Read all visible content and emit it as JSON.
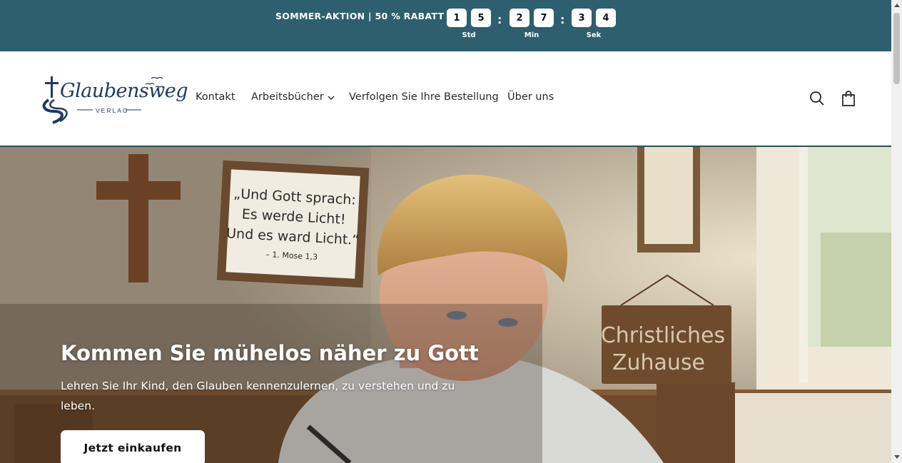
{
  "promo": {
    "text": "SOMMER-AKTION | 50 % RABATT",
    "countdown": {
      "hours": [
        "1",
        "5"
      ],
      "minutes": [
        "2",
        "7"
      ],
      "seconds": [
        "3",
        "4"
      ],
      "separator": ":",
      "labels": {
        "hours": "Std",
        "minutes": "Min",
        "seconds": "Sek"
      }
    },
    "background_color": "#2e5f6f"
  },
  "header": {
    "logo": {
      "name": "Glaubensweg",
      "sub": "VERLAG"
    },
    "nav": [
      {
        "label": "Kontakt"
      },
      {
        "label": "Arbeitsbücher",
        "has_dropdown": true
      },
      {
        "label": "Verfolgen Sie Ihre Bestellung"
      },
      {
        "label": "Über uns"
      }
    ],
    "icons": [
      "search-icon",
      "cart-icon"
    ]
  },
  "hero": {
    "wall_plaque": {
      "line1": "„Und Gott sprach:",
      "line2": "Es werde Licht!",
      "line3": "Und es ward Licht.“",
      "line4": "– 1. Mose 1,3"
    },
    "wood_sign": {
      "line1": "Christliches",
      "line2": "Zuhause"
    },
    "title": "Kommen Sie mühelos näher zu Gott",
    "subtitle": "Lehren Sie Ihr Kind, den Glauben kennenzulernen, zu verstehen und zu leben.",
    "button_label": "Jetzt einkaufen"
  }
}
